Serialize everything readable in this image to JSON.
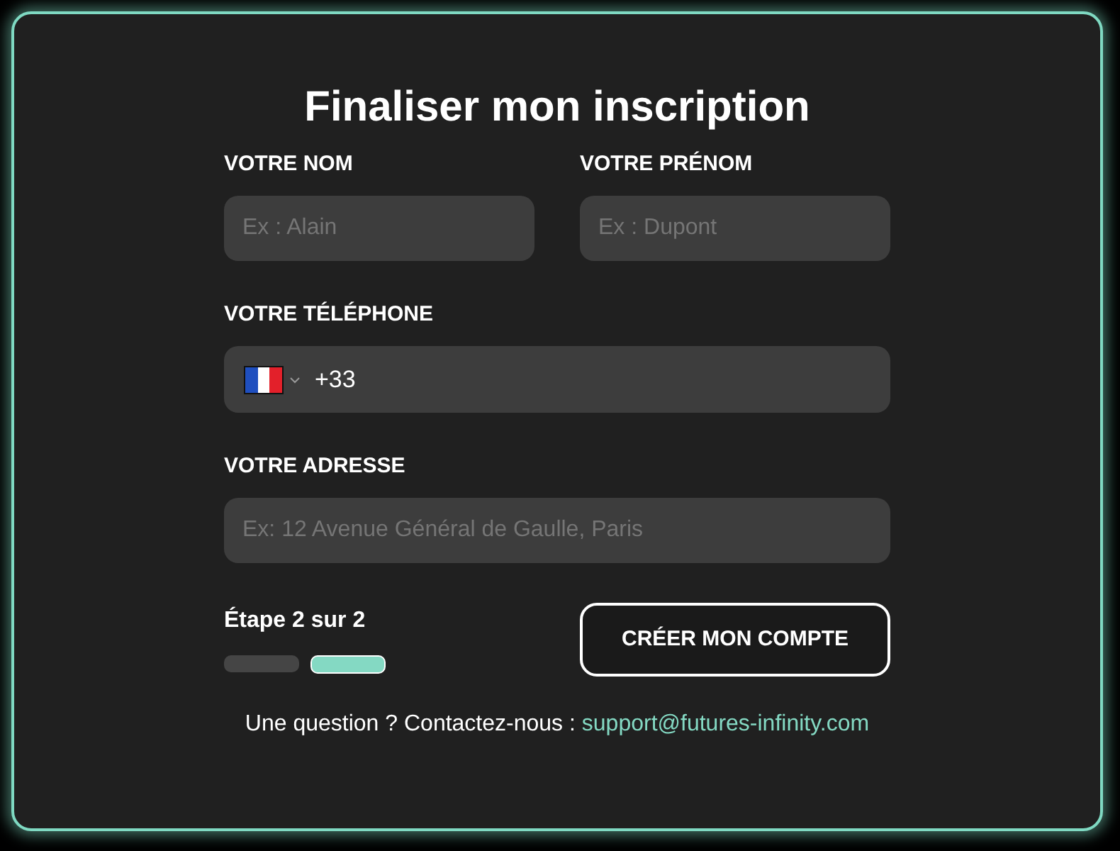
{
  "title": "Finaliser mon inscription",
  "name_field": {
    "label": "VOTRE NOM",
    "placeholder": "Ex : Alain"
  },
  "first_name_field": {
    "label": "VOTRE PRÉNOM",
    "placeholder": "Ex : Dupont"
  },
  "phone_field": {
    "label": "VOTRE TÉLÉPHONE",
    "value": "+33"
  },
  "address_field": {
    "label": "VOTRE ADRESSE",
    "placeholder": "Ex: 12 Avenue Général de Gaulle, Paris"
  },
  "step_label": "Étape 2 sur 2",
  "steps": [
    {
      "selected": false
    },
    {
      "selected": true
    }
  ],
  "submit_button": "CRÉER MON COMPTE",
  "contact": {
    "text": "Une question ? Contactez-nous :",
    "email": "support@futures-infinity.com"
  }
}
